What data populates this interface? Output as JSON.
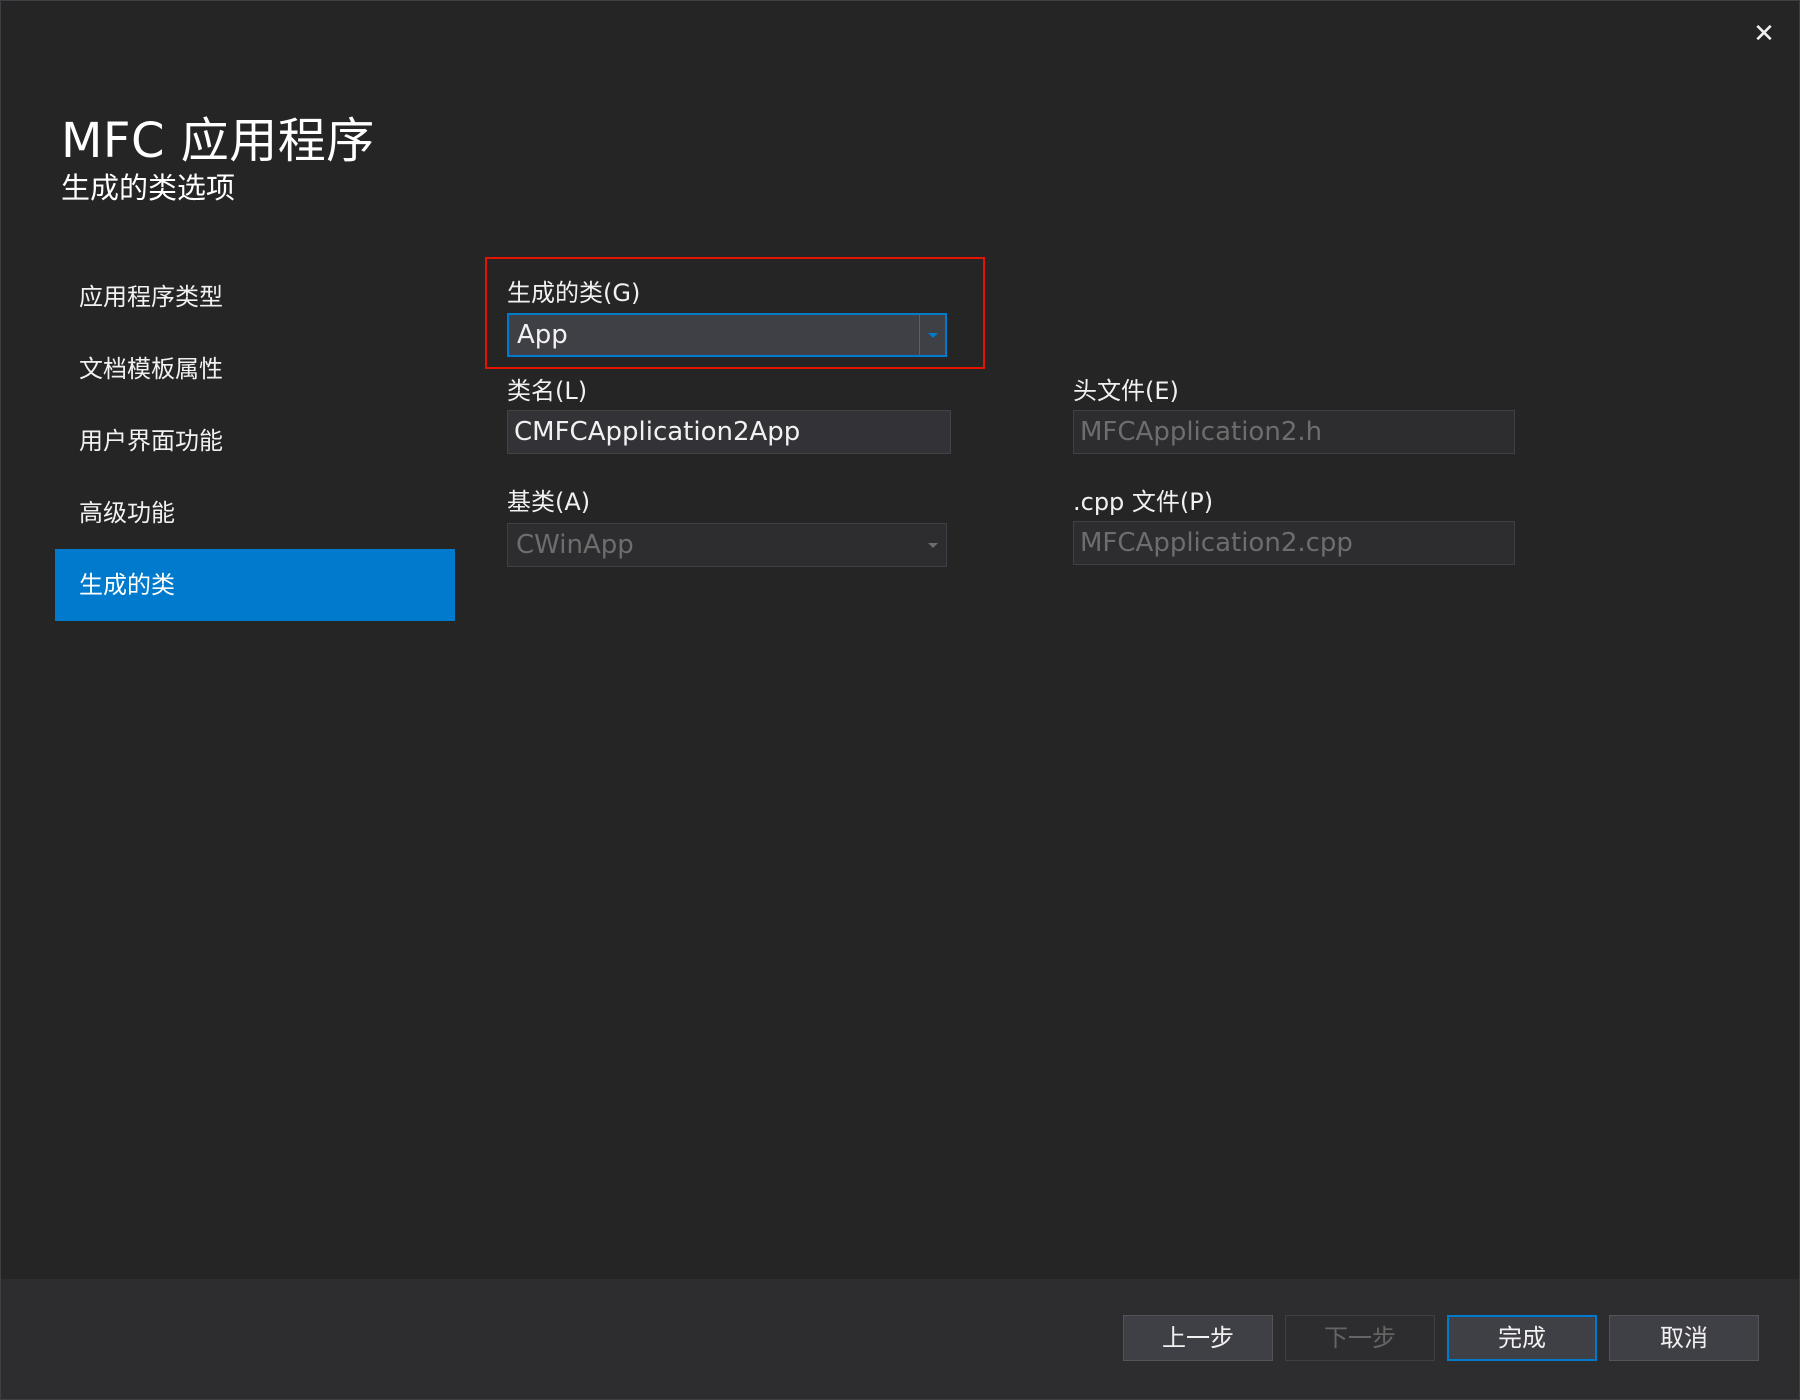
{
  "window": {
    "title": "MFC 应用程序",
    "subtitle": "生成的类选项",
    "close_glyph": "✕"
  },
  "nav": {
    "items": [
      {
        "label": "应用程序类型",
        "active": false
      },
      {
        "label": "文档模板属性",
        "active": false
      },
      {
        "label": "用户界面功能",
        "active": false
      },
      {
        "label": "高级功能",
        "active": false
      },
      {
        "label": "生成的类",
        "active": true
      }
    ]
  },
  "form": {
    "generated_class_label": "生成的类(G)",
    "generated_class_value": "App",
    "class_name_label": "类名(L)",
    "class_name_value": "CMFCApplication2App",
    "header_file_label": "头文件(E)",
    "header_file_value": "MFCApplication2.h",
    "base_class_label": "基类(A)",
    "base_class_value": "CWinApp",
    "cpp_file_label": ".cpp 文件(P)",
    "cpp_file_value": "MFCApplication2.cpp"
  },
  "footer": {
    "back_label": "上一步",
    "next_label": "下一步",
    "finish_label": "完成",
    "cancel_label": "取消"
  },
  "colors": {
    "accent": "#007acc",
    "highlight": "#e51400",
    "background": "#252526"
  },
  "icons": {
    "close": "close-icon",
    "dropdown": "chevron-down-icon"
  }
}
